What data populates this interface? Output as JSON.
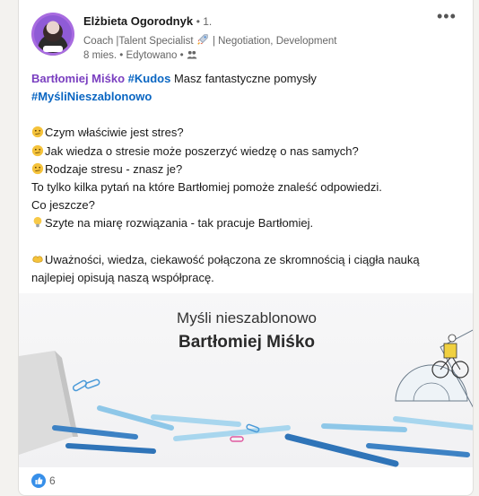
{
  "post": {
    "author": {
      "name": "Elżbieta Ogorodnyk",
      "degree": "• 1.",
      "headline_part1": "Coach |Talent Specialist",
      "headline_part2": "| Negotiation, Development",
      "time": "8 mies. • Edytowano •"
    },
    "mention": "Bartłomiej Miśko",
    "kudos_tag": "#Kudos",
    "intro_rest": " Masz fantastyczne pomysły",
    "hashtag2": "#MyśliNieszablonowo",
    "lines": {
      "q1": "Czym właściwie jest stres?",
      "q2": "Jak wiedza o stresie może poszerzyć wiedzę o nas samych?",
      "q3": "Rodzaje stresu - znasz je?",
      "l4": "To tylko kilka pytań na które Bartłomiej pomoże znaleść odpowiedzi.",
      "l5": "Co jeszcze?",
      "l6": "Szyte na miarę rozwiązania - tak pracuje Bartłomiej.",
      "l7": "Uważności, wiedza, ciekawość połączona ze skromnością i ciągła nauką",
      "l8": "najlepiej opisują naszą współpracę."
    },
    "image": {
      "title_line1": "Myśli nieszablonowo",
      "title_line2": "Bartłomiej Miśko"
    },
    "reactions": {
      "count": "6"
    }
  },
  "icons": {
    "avatar_badge": "badge",
    "rocket": "rocket-icon",
    "group": "group-icon",
    "more": "more-horizontal-icon",
    "like": "like-icon"
  },
  "colors": {
    "mention": "#7a3fc0",
    "hashtag": "#0a66c2",
    "like": "#378fe9"
  }
}
